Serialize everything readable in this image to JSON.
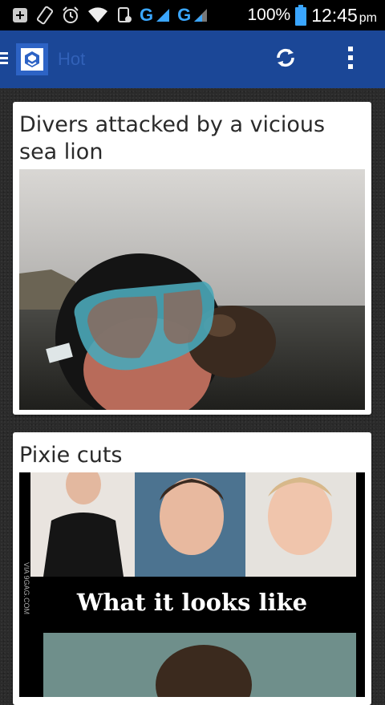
{
  "status_bar": {
    "network_1": "G",
    "network_2": "G",
    "battery_pct": "100%",
    "time": "12:45",
    "ampm": "pm",
    "icons": [
      "notification-icon",
      "rotation-icon",
      "alarm-icon",
      "wifi-icon",
      "data-icon",
      "signal-icon",
      "battery-icon"
    ]
  },
  "app_bar": {
    "title": "Hot",
    "logo": "9gag-logo",
    "actions": [
      "refresh-icon",
      "overflow-menu-icon"
    ],
    "accent": "#1b4797"
  },
  "posts": [
    {
      "title": "Divers attacked by a vicious sea lion",
      "image": "diver-sea-lion-photo"
    },
    {
      "title": "Pixie cuts",
      "image_caption": "What it looks like",
      "image_watermark": "VIA 9GAG.COM",
      "image": "pixie-cuts-meme"
    }
  ]
}
